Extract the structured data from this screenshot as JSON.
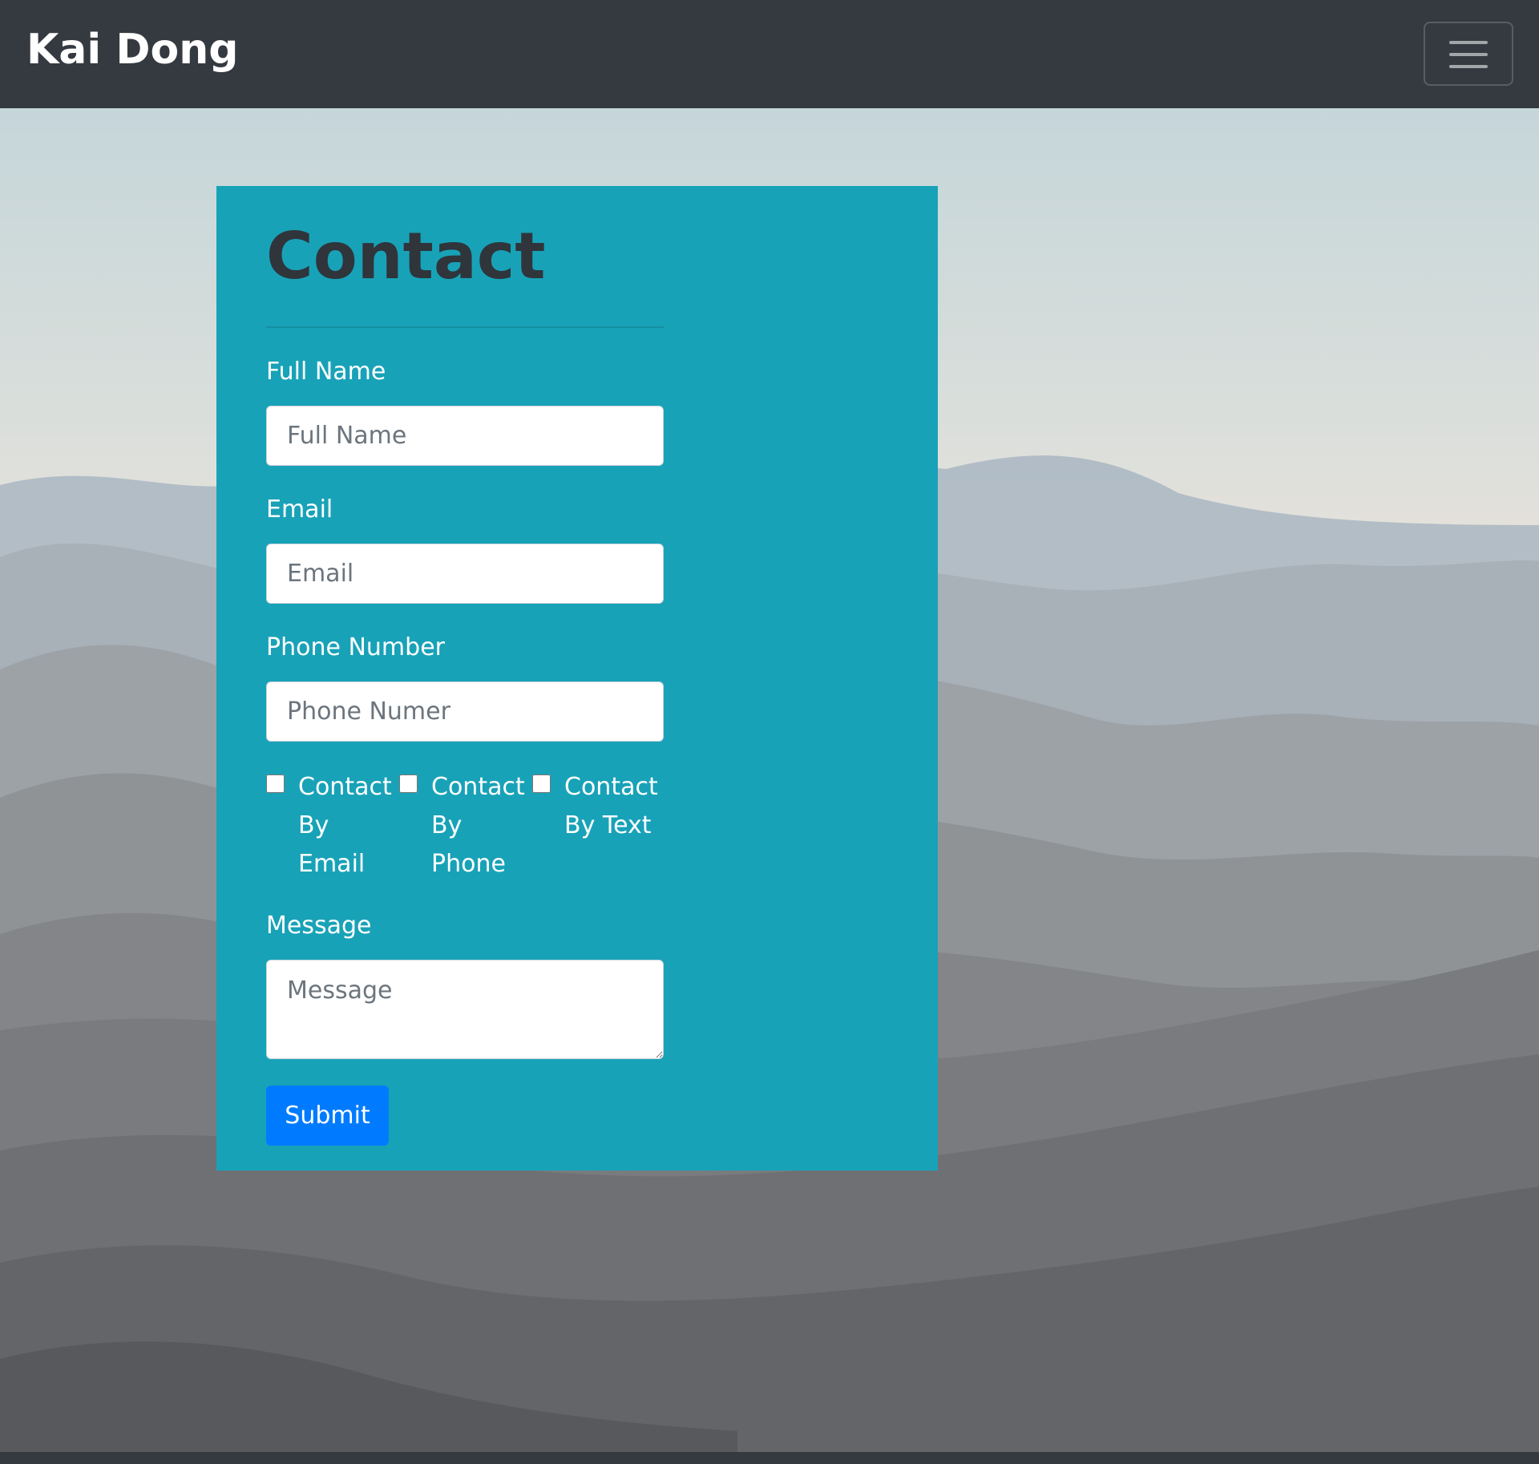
{
  "navbar": {
    "brand": "Kai Dong",
    "toggler_icon": "hamburger-menu-icon"
  },
  "contact": {
    "title": "Contact",
    "fields": {
      "full_name": {
        "label": "Full Name",
        "placeholder": "Full Name",
        "value": ""
      },
      "email": {
        "label": "Email",
        "placeholder": "Email",
        "value": ""
      },
      "phone": {
        "label": "Phone Number",
        "placeholder": "Phone Numer",
        "value": ""
      },
      "message": {
        "label": "Message",
        "placeholder": "Message",
        "value": ""
      }
    },
    "checkboxes": [
      {
        "label": "Contact By Email",
        "checked": false
      },
      {
        "label": "Contact By Phone",
        "checked": false
      },
      {
        "label": "Contact By Text",
        "checked": false
      }
    ],
    "submit_label": "Submit"
  },
  "colors": {
    "navbar": "#343a40",
    "card": "#18a2b8",
    "button": "#007bff",
    "title": "#2f353b"
  }
}
